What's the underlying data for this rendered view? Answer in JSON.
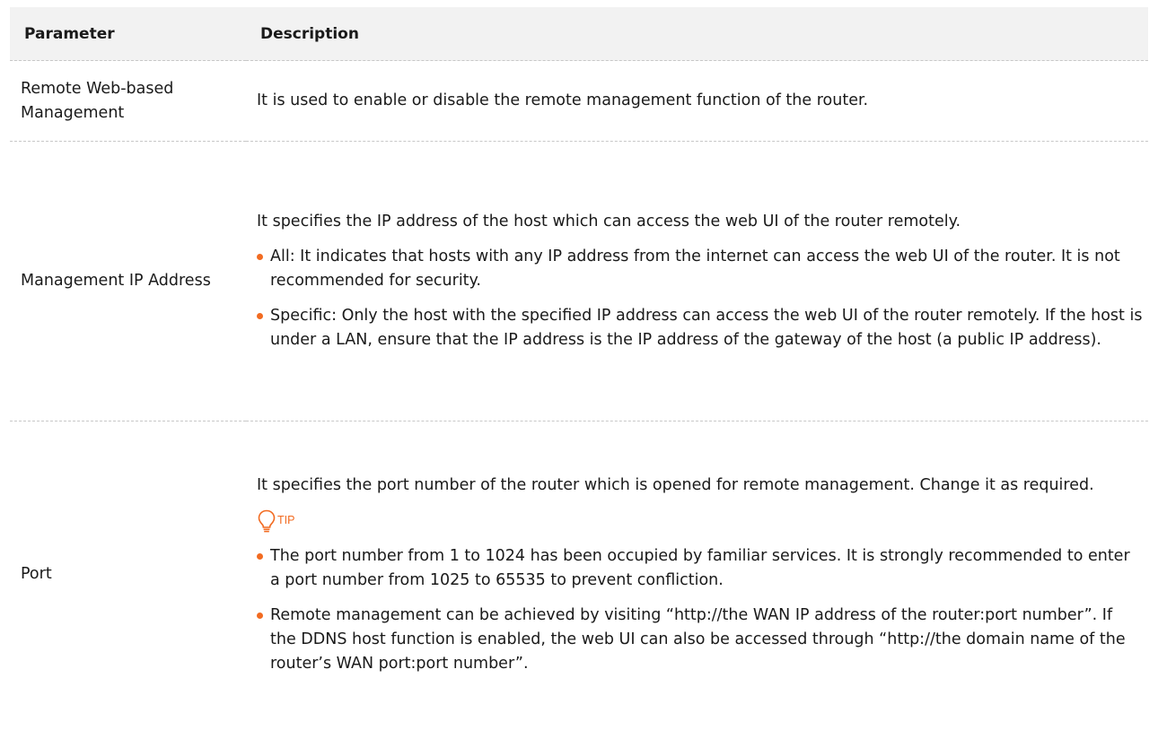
{
  "table": {
    "header": {
      "param": "Parameter",
      "desc": "Description"
    },
    "rows": [
      {
        "param": "Remote Web-based Management",
        "intro": "It is used to enable or disable the remote management function of the router."
      },
      {
        "param": "Management IP Address",
        "intro": "It specifies the IP address of the host which can access the web UI of the router remotely.",
        "bullets": [
          "All: It indicates that hosts with any IP address from the internet can access the web UI of the router. It is not recommended for security.",
          "Specific: Only the host with the specified IP address can access the web UI of the router remotely. If the host is under a LAN, ensure that the IP address is the IP address of the gateway of the host (a public IP address)."
        ]
      },
      {
        "param": "Port",
        "intro": "It specifies the port number of the router which is opened for remote management. Change it as required.",
        "tip_label": "TIP",
        "bullets": [
          "The port number from 1 to 1024 has been occupied by familiar services. It is strongly recommended to enter a port number from 1025 to 65535 to prevent confliction.",
          "Remote management can be achieved by visiting “http://the WAN IP address of the router:port number”. If the DDNS host function is enabled, the web UI can also be accessed through “http://the domain name of the router’s WAN port:port number”."
        ]
      }
    ]
  },
  "colors": {
    "accent": "#f26b21",
    "header_bg": "#f2f2f2",
    "divider": "#c8c8c8"
  },
  "icons": {
    "tip": "lightbulb-icon",
    "bullet": "bullet-dot-icon"
  }
}
